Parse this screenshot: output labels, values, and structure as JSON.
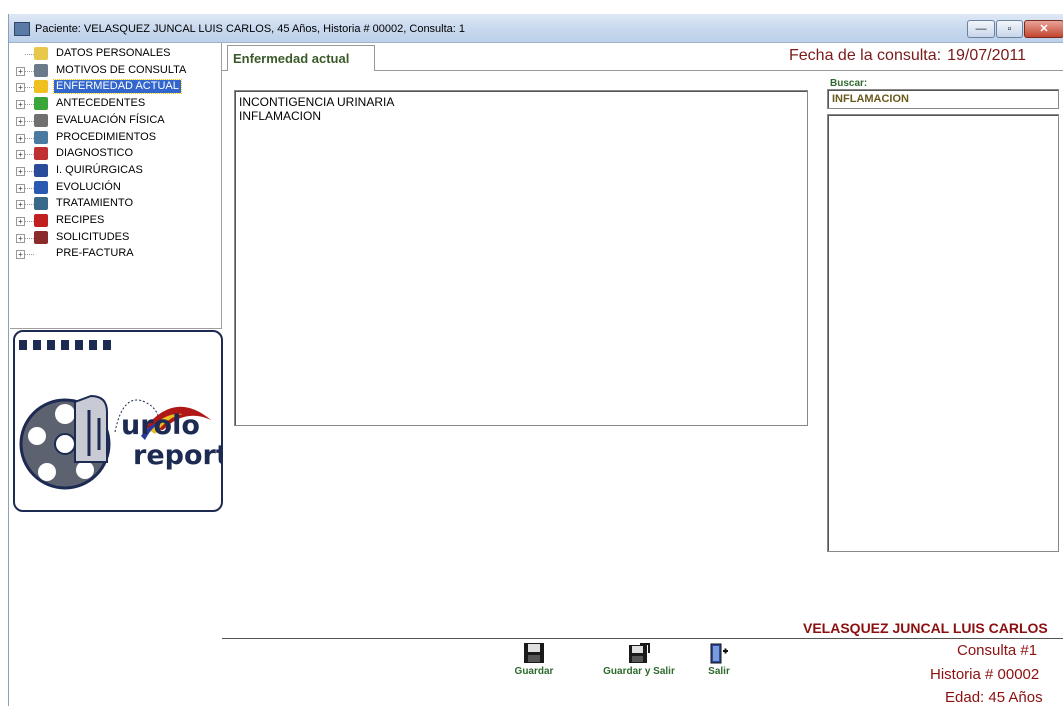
{
  "window": {
    "title": "Paciente: VELASQUEZ JUNCAL LUIS CARLOS, 45 Años, Historia # 00002, Consulta: 1",
    "min_glyph": "—",
    "max_glyph": "▫",
    "close_glyph": "✕"
  },
  "tree": {
    "items": [
      {
        "label": "DATOS PERSONALES",
        "icon": "folder-icon",
        "color": "#e8c84a",
        "expander": ""
      },
      {
        "label": "MOTIVOS DE CONSULTA",
        "icon": "pointer-icon",
        "color": "#6a7a8a",
        "expander": "+"
      },
      {
        "label": "ENFERMEDAD ACTUAL",
        "icon": "lightning-icon",
        "color": "#f0c020",
        "expander": "+",
        "selected": true
      },
      {
        "label": "ANTECEDENTES",
        "icon": "apple-icon",
        "color": "#3aa63a",
        "expander": "+"
      },
      {
        "label": "EVALUACIÓN FÍSICA",
        "icon": "stethoscope-icon",
        "color": "#707070",
        "expander": "+"
      },
      {
        "label": "PROCEDIMIENTOS",
        "icon": "monitor-icon",
        "color": "#4a7aa0",
        "expander": "+"
      },
      {
        "label": "DIAGNOSTICO",
        "icon": "syringe-icon",
        "color": "#c03030",
        "expander": "+"
      },
      {
        "label": "I. QUIRÚRGICAS",
        "icon": "grid-icon",
        "color": "#2a4a9a",
        "expander": "+"
      },
      {
        "label": "EVOLUCIÓN",
        "icon": "info-icon",
        "color": "#2a5ab0",
        "expander": "+"
      },
      {
        "label": "TRATAMIENTO",
        "icon": "person-icon",
        "color": "#3a6a8a",
        "expander": "+"
      },
      {
        "label": "RECIPES",
        "icon": "apple-red-icon",
        "color": "#c02020",
        "expander": "+"
      },
      {
        "label": "SOLICITUDES",
        "icon": "chart-icon",
        "color": "#8a2a2a",
        "expander": "+"
      },
      {
        "label": "PRE-FACTURA",
        "icon": "",
        "color": "",
        "expander": "+"
      }
    ]
  },
  "logo": {
    "line1": "urolo",
    "line2": "report"
  },
  "tab": {
    "label": "Enfermedad actual"
  },
  "header": {
    "fecha_label": "Fecha de la consulta:",
    "fecha_value": "19/07/2011"
  },
  "editor": {
    "lines": [
      "INCONTIGENCIA URINARIA",
      "INFLAMACION"
    ]
  },
  "search": {
    "label": "Buscar:",
    "value": "INFLAMACION"
  },
  "footer": {
    "patient_name": "VELASQUEZ JUNCAL LUIS CARLOS",
    "consulta": "Consulta #1",
    "historia": "Historia # 00002",
    "edad": "Edad: 45 Años"
  },
  "toolbar": {
    "guardar": "Guardar",
    "guardar_salir": "Guardar y Salir",
    "salir": "Salir"
  }
}
